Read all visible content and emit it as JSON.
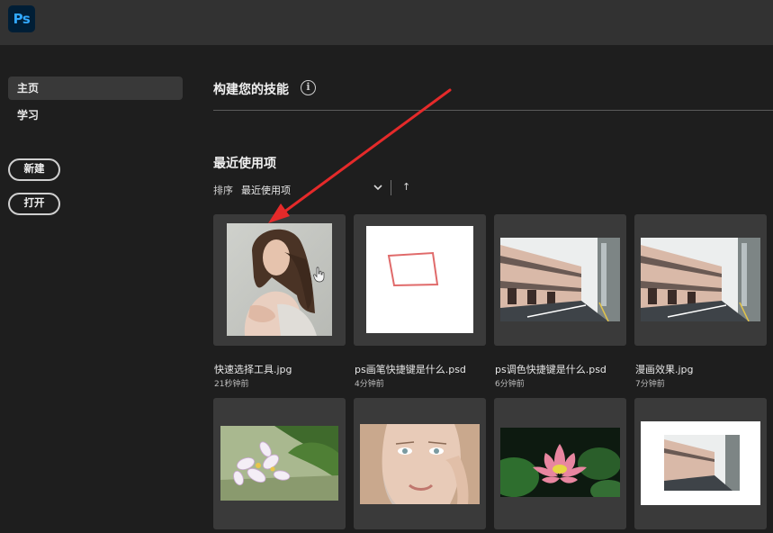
{
  "app": {
    "logo_text": "Ps"
  },
  "sidebar": {
    "items": [
      {
        "label": "主页",
        "active": true
      },
      {
        "label": "学习",
        "active": false
      }
    ],
    "new_button": "新建",
    "open_button": "打开"
  },
  "main": {
    "skills_title": "构建您的技能",
    "info_icon_glyph": "i",
    "recent_title": "最近使用项",
    "sort_label": "排序",
    "sort_value": "最近使用项",
    "sort_direction_glyph": "↑"
  },
  "files": [
    {
      "name": "快速选择工具.jpg",
      "time": "21秒钟前",
      "thumb": "woman-portrait"
    },
    {
      "name": "ps画笔快捷键是什么.psd",
      "time": "4分钟前",
      "thumb": "sketch"
    },
    {
      "name": "ps调色快捷键是什么.psd",
      "time": "6分钟前",
      "thumb": "street"
    },
    {
      "name": "漫画效果.jpg",
      "time": "7分钟前",
      "thumb": "street"
    },
    {
      "name": "",
      "time": "",
      "thumb": "flower"
    },
    {
      "name": "",
      "time": "",
      "thumb": "face"
    },
    {
      "name": "",
      "time": "",
      "thumb": "lotus"
    },
    {
      "name": "",
      "time": "",
      "thumb": "street-framed"
    }
  ],
  "colors": {
    "annotation_arrow": "#e52a2a",
    "ps_blue": "#31a8ff",
    "ps_dark": "#001e36"
  }
}
